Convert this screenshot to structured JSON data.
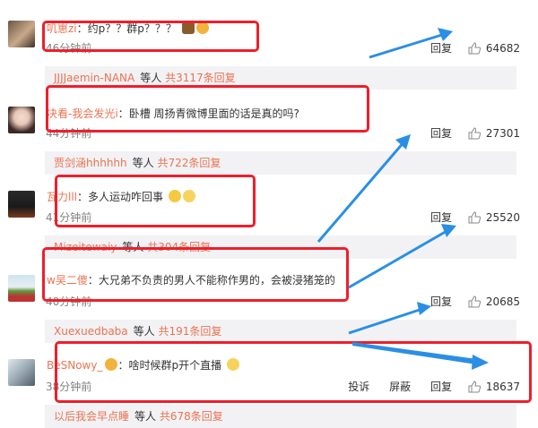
{
  "comments": [
    {
      "username": "叽崽zi",
      "text": "约p？？群p？？？",
      "time": "46分钟前",
      "reply_label": "回复",
      "likes": "64682"
    },
    {
      "username": "决看-我会发光i",
      "text": "卧槽 周扬青微博里面的话是真的吗?",
      "time": "44分钟前",
      "reply_label": "回复",
      "likes": "27301"
    },
    {
      "username": "瓦力lll",
      "text": "多人运动咋回事",
      "time": "41分钟前",
      "reply_label": "回复",
      "likes": "25520"
    },
    {
      "username": "w吴二傻",
      "text": "大兄弟不负责的男人不能称作男的，会被浸猪笼的",
      "time": "40分钟前",
      "reply_label": "回复",
      "likes": "20685"
    },
    {
      "username": "BeSNowy_",
      "text": "啥时候群p开个直播",
      "time": "38分钟前",
      "report_label": "投诉",
      "block_label": "屏蔽",
      "reply_label": "回复",
      "likes": "18637"
    }
  ],
  "reply_threads": [
    {
      "user": "JJJJaemin-NANA",
      "middle": "等人",
      "count_text": "共3117条回复"
    },
    {
      "user": "贾剑涵hhhhhh",
      "middle": "等人",
      "count_text": "共722条回复"
    },
    {
      "user": "Mizeitewaiy",
      "middle": "等人",
      "count_text": "共304条回复"
    },
    {
      "user": "Xuexuedbaba",
      "middle": "等人",
      "count_text": "共191条回复"
    },
    {
      "user": "以后我会早点睡",
      "middle": "等人",
      "count_text": "共678条回复"
    }
  ],
  "colors": {
    "username": "#eb7350",
    "highlight": "#ee1f2b",
    "arrow": "#2a8fe4",
    "reply_bar_bg": "#f2f2f5"
  },
  "icons": {
    "like": "thumbs-up-icon",
    "emoji": "emoji-icon"
  }
}
